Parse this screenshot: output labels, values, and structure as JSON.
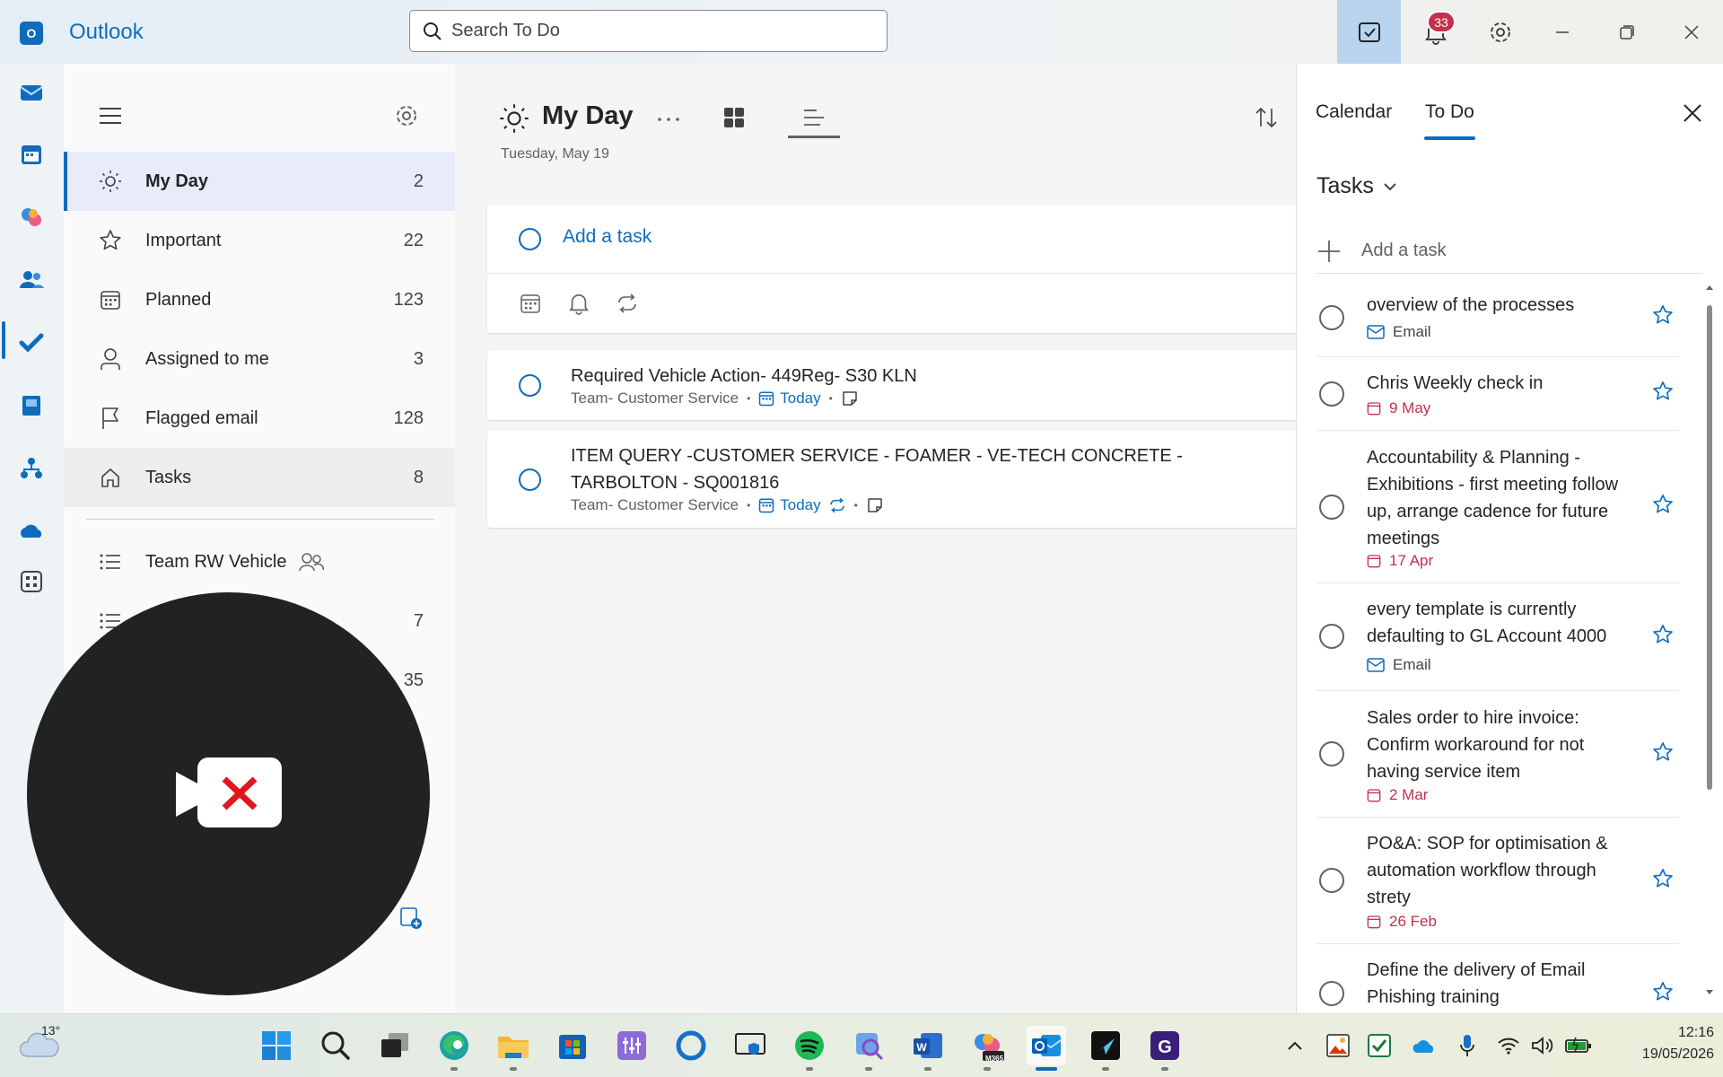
{
  "titlebar": {
    "app_name": "Outlook",
    "search_placeholder": "Search To Do",
    "notification_count": "33"
  },
  "nav": {
    "items": [
      {
        "label": "My Day",
        "count": "2",
        "icon": "sun-icon"
      },
      {
        "label": "Important",
        "count": "22",
        "icon": "star-icon"
      },
      {
        "label": "Planned",
        "count": "123",
        "icon": "calendar-icon"
      },
      {
        "label": "Assigned to me",
        "count": "3",
        "icon": "person-icon"
      },
      {
        "label": "Flagged email",
        "count": "128",
        "icon": "flag-icon"
      },
      {
        "label": "Tasks",
        "count": "8",
        "icon": "home-icon"
      }
    ],
    "lists": [
      {
        "label": "Team RW Vehicle",
        "count": "",
        "icon": "list-icon",
        "shared": true
      },
      {
        "label": "",
        "count": "7",
        "icon": "list-icon"
      },
      {
        "label": "",
        "count": "35",
        "icon": "list-icon"
      }
    ]
  },
  "main": {
    "title": "My Day",
    "date": "Tuesday, May 19",
    "add_task_placeholder": "Add a task",
    "tasks": [
      {
        "title": "Required Vehicle Action- 449Reg- S30 KLN",
        "list": "Team- Customer Service",
        "due": "Today",
        "recurring": false
      },
      {
        "title": "ITEM QUERY -CUSTOMER SERVICE - FOAMER - VE-TECH CONCRETE - TARBOLTON - SQ001816",
        "list": "Team- Customer Service",
        "due": "Today",
        "recurring": true
      }
    ]
  },
  "right_pane": {
    "tabs": [
      "Calendar",
      "To Do"
    ],
    "active_tab": "To Do",
    "section_title": "Tasks",
    "add_task_placeholder": "Add a task",
    "tasks": [
      {
        "title": "overview of the processes",
        "meta_type": "email",
        "meta": "Email"
      },
      {
        "title": "Chris Weekly check in",
        "meta_type": "due",
        "meta": "9 May"
      },
      {
        "title": "Accountability & Planning - Exhibitions - first meeting follow up, arrange cadence for future meetings",
        "meta_type": "due",
        "meta": "17 Apr"
      },
      {
        "title": "every template is currently defaulting to GL Account 4000",
        "meta_type": "email",
        "meta": "Email"
      },
      {
        "title": "Sales order to hire invoice: Confirm workaround for not having service item",
        "meta_type": "due",
        "meta": "2 Mar"
      },
      {
        "title": "PO&A: SOP for optimisation & automation workflow through strety",
        "meta_type": "due",
        "meta": "26 Feb"
      },
      {
        "title": "Define the delivery of Email Phishing training",
        "meta_type": "none",
        "meta": ""
      }
    ]
  },
  "taskbar": {
    "temperature": "13°",
    "time": "12:16",
    "date": "19/05/2026",
    "m365_label": "M365"
  },
  "colors": {
    "accent": "#0f6cbd",
    "overdue": "#c4314b",
    "badge": "#c4314b"
  }
}
